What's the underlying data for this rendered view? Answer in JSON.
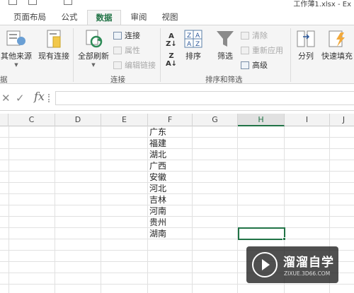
{
  "window": {
    "title": "工作薄1.xlsx - Ex"
  },
  "tabs": [
    {
      "label": "页面布局"
    },
    {
      "label": "公式"
    },
    {
      "label": "数据",
      "active": true
    },
    {
      "label": "审阅"
    },
    {
      "label": "视图"
    }
  ],
  "ribbon": {
    "other_sources": "其他来源",
    "existing_connections": "现有连接",
    "refresh_all": "全部刷新",
    "connections": "连接",
    "properties": "属性",
    "edit_links": "编辑链接",
    "sort": "排序",
    "filter": "筛选",
    "clear": "清除",
    "reapply": "重新应用",
    "advanced": "高级",
    "text_to_columns": "分列",
    "flash_fill": "快速填充",
    "groups": {
      "get_data": "据",
      "connections": "连接",
      "sort_filter": "排序和筛选"
    }
  },
  "formula_bar": {
    "fx": "fx",
    "value": ""
  },
  "columns": [
    "C",
    "D",
    "E",
    "F",
    "G",
    "H",
    "I",
    "J"
  ],
  "selected_column": "H",
  "cells_F": [
    "广东",
    "福建",
    "湖北",
    "广西",
    "安徽",
    "河北",
    "吉林",
    "河南",
    "贵州",
    "湖南"
  ],
  "watermark": {
    "name": "溜溜自学",
    "url": "ZIXUE.3D66.COM"
  },
  "colors": {
    "accent": "#217346",
    "ribbon_bg": "#f5f5f5"
  }
}
